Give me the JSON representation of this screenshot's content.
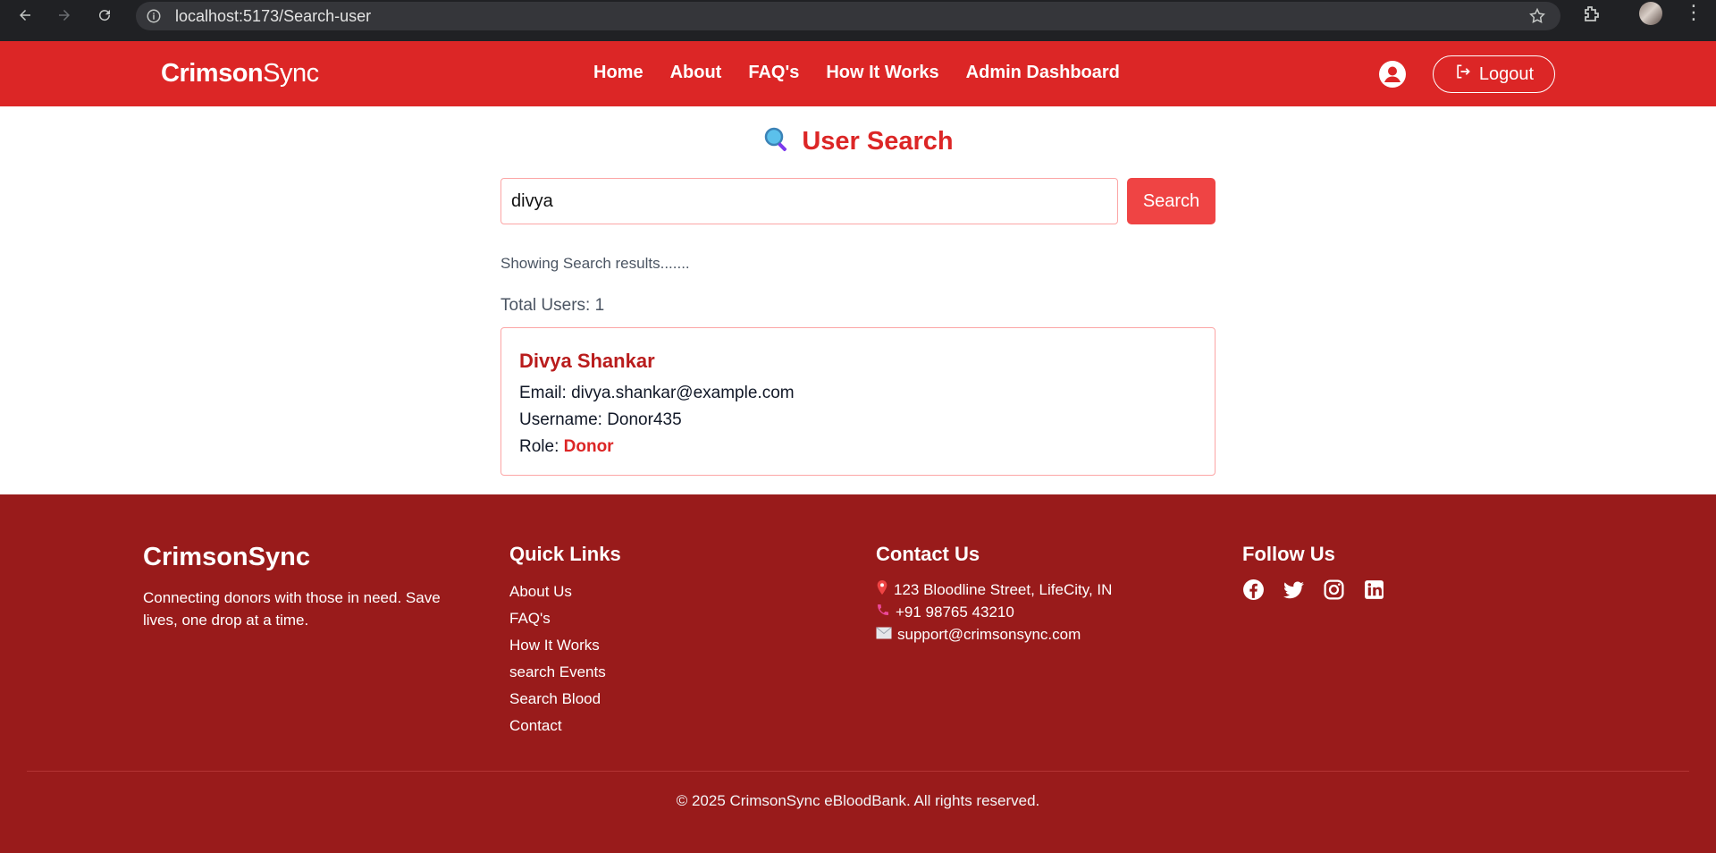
{
  "browser": {
    "url": "localhost:5173/Search-user"
  },
  "header": {
    "brand_bold": "Crimson",
    "brand_light": "Sync",
    "nav": [
      "Home",
      "About",
      "FAQ's",
      "How It Works",
      "Admin Dashboard"
    ],
    "logout_label": "Logout"
  },
  "main": {
    "title": "User Search",
    "search_value": "divya",
    "search_button": "Search",
    "showing_text": "Showing Search results.......",
    "total_text": "Total Users: 1",
    "results": [
      {
        "name": "Divya Shankar",
        "email_label": "Email:",
        "email": "divya.shankar@example.com",
        "username_label": "Username:",
        "username": "Donor435",
        "role_label": "Role:",
        "role": "Donor"
      }
    ]
  },
  "footer": {
    "brand": "CrimsonSync",
    "description": "Connecting donors with those in need. Save lives, one drop at a time.",
    "quick_links_title": "Quick Links",
    "quick_links": [
      "About Us",
      "FAQ's",
      "How It Works",
      "search Events",
      "Search Blood",
      "Contact"
    ],
    "contact_title": "Contact Us",
    "contact": {
      "address": "123 Bloodline Street, LifeCity, IN",
      "phone": "+91 98765 43210",
      "email": "support@crimsonsync.com"
    },
    "follow_title": "Follow Us",
    "social": [
      "facebook-icon",
      "twitter-icon",
      "instagram-icon",
      "linkedin-icon"
    ],
    "copyright": "© 2025 CrimsonSync eBloodBank. All rights reserved."
  },
  "colors": {
    "header_red": "#dc2626",
    "footer_red": "#991b1b",
    "button_red": "#ef4444",
    "border_pink": "#fca5a5"
  }
}
